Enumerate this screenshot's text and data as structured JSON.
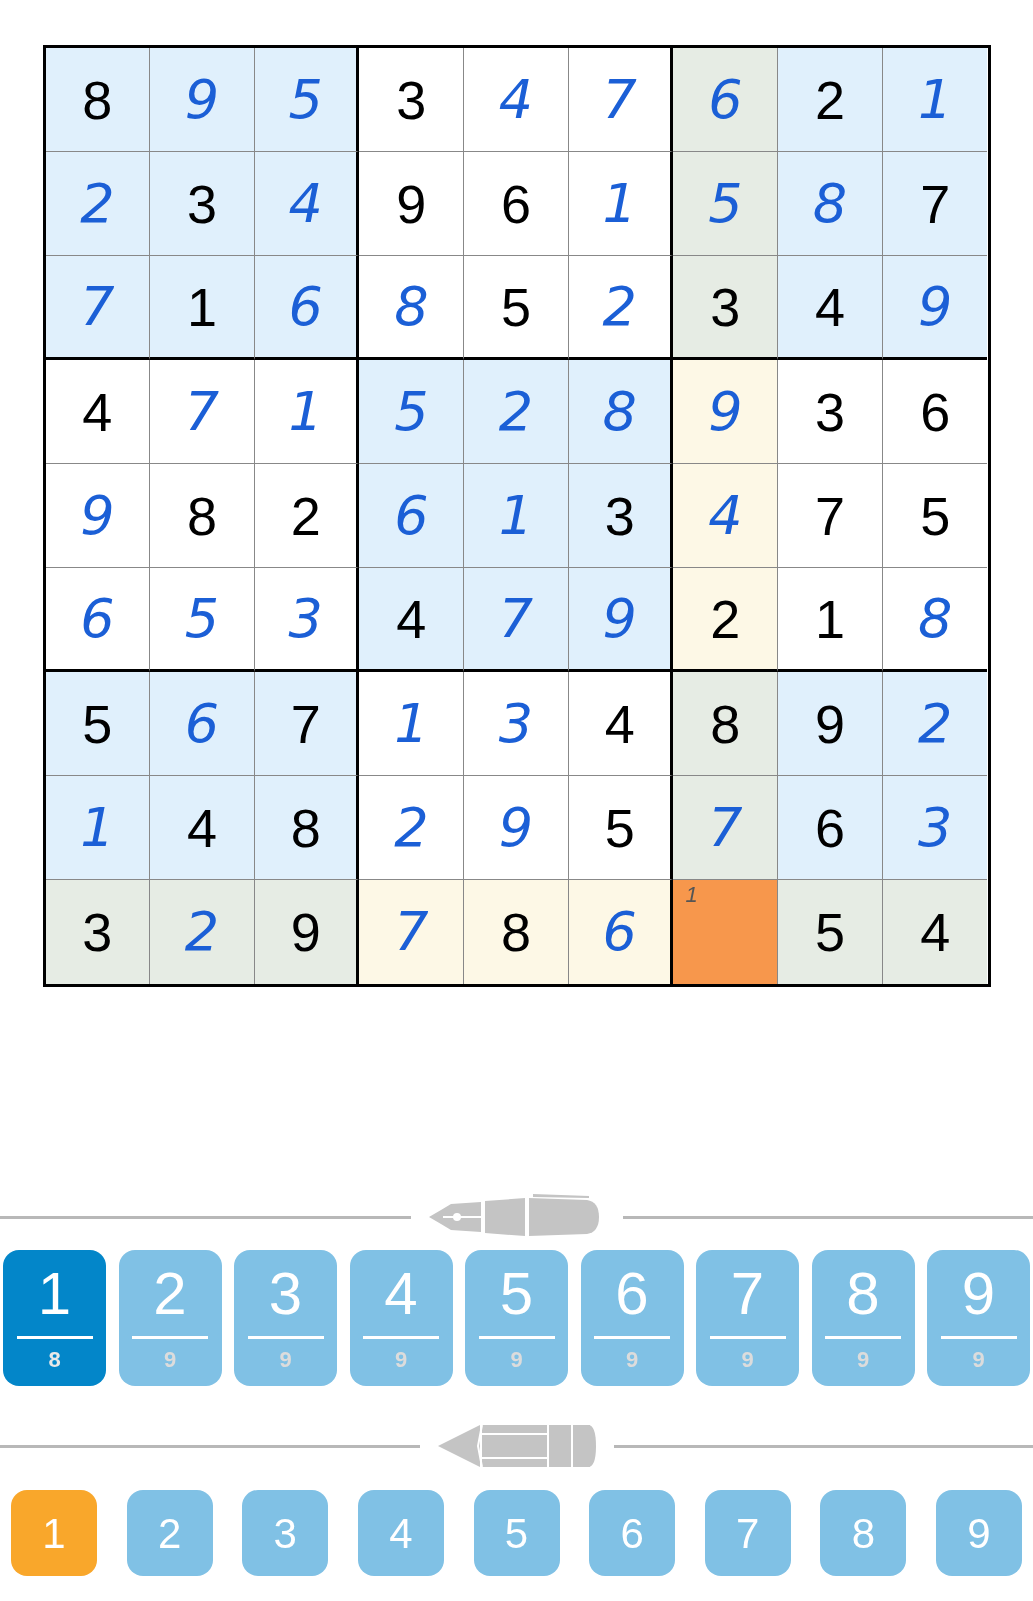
{
  "grid": [
    [
      {
        "value": "8",
        "kind": "given",
        "color": "#e0f0fc"
      },
      {
        "value": "9",
        "kind": "entered",
        "color": "#e0f0fc"
      },
      {
        "value": "5",
        "kind": "entered",
        "color": "#e0f0fc"
      },
      {
        "value": "3",
        "kind": "given",
        "color": "#ffffff"
      },
      {
        "value": "4",
        "kind": "entered",
        "color": "#ffffff"
      },
      {
        "value": "7",
        "kind": "entered",
        "color": "#ffffff"
      },
      {
        "value": "6",
        "kind": "entered",
        "color": "#e6ece4"
      },
      {
        "value": "2",
        "kind": "given",
        "color": "#e0f0fc"
      },
      {
        "value": "1",
        "kind": "entered",
        "color": "#e0f0fc"
      }
    ],
    [
      {
        "value": "2",
        "kind": "entered",
        "color": "#e0f0fc"
      },
      {
        "value": "3",
        "kind": "given",
        "color": "#e0f0fc"
      },
      {
        "value": "4",
        "kind": "entered",
        "color": "#e0f0fc"
      },
      {
        "value": "9",
        "kind": "given",
        "color": "#ffffff"
      },
      {
        "value": "6",
        "kind": "given",
        "color": "#ffffff"
      },
      {
        "value": "1",
        "kind": "entered",
        "color": "#ffffff"
      },
      {
        "value": "5",
        "kind": "entered",
        "color": "#e6ece4"
      },
      {
        "value": "8",
        "kind": "entered",
        "color": "#e0f0fc"
      },
      {
        "value": "7",
        "kind": "given",
        "color": "#e0f0fc"
      }
    ],
    [
      {
        "value": "7",
        "kind": "entered",
        "color": "#e0f0fc"
      },
      {
        "value": "1",
        "kind": "given",
        "color": "#e0f0fc"
      },
      {
        "value": "6",
        "kind": "entered",
        "color": "#e0f0fc"
      },
      {
        "value": "8",
        "kind": "entered",
        "color": "#ffffff"
      },
      {
        "value": "5",
        "kind": "given",
        "color": "#ffffff"
      },
      {
        "value": "2",
        "kind": "entered",
        "color": "#ffffff"
      },
      {
        "value": "3",
        "kind": "given",
        "color": "#e6ece4"
      },
      {
        "value": "4",
        "kind": "given",
        "color": "#e0f0fc"
      },
      {
        "value": "9",
        "kind": "entered",
        "color": "#e0f0fc"
      }
    ],
    [
      {
        "value": "4",
        "kind": "given",
        "color": "#ffffff"
      },
      {
        "value": "7",
        "kind": "entered",
        "color": "#ffffff"
      },
      {
        "value": "1",
        "kind": "entered",
        "color": "#ffffff"
      },
      {
        "value": "5",
        "kind": "entered",
        "color": "#e0f0fc"
      },
      {
        "value": "2",
        "kind": "entered",
        "color": "#e0f0fc"
      },
      {
        "value": "8",
        "kind": "entered",
        "color": "#e0f0fc"
      },
      {
        "value": "9",
        "kind": "entered",
        "color": "#fdf8e6"
      },
      {
        "value": "3",
        "kind": "given",
        "color": "#ffffff"
      },
      {
        "value": "6",
        "kind": "given",
        "color": "#ffffff"
      }
    ],
    [
      {
        "value": "9",
        "kind": "entered",
        "color": "#ffffff"
      },
      {
        "value": "8",
        "kind": "given",
        "color": "#ffffff"
      },
      {
        "value": "2",
        "kind": "given",
        "color": "#ffffff"
      },
      {
        "value": "6",
        "kind": "entered",
        "color": "#e0f0fc"
      },
      {
        "value": "1",
        "kind": "entered",
        "color": "#e0f0fc"
      },
      {
        "value": "3",
        "kind": "given",
        "color": "#e0f0fc"
      },
      {
        "value": "4",
        "kind": "entered",
        "color": "#fdf8e6"
      },
      {
        "value": "7",
        "kind": "given",
        "color": "#ffffff"
      },
      {
        "value": "5",
        "kind": "given",
        "color": "#ffffff"
      }
    ],
    [
      {
        "value": "6",
        "kind": "entered",
        "color": "#ffffff"
      },
      {
        "value": "5",
        "kind": "entered",
        "color": "#ffffff"
      },
      {
        "value": "3",
        "kind": "entered",
        "color": "#ffffff"
      },
      {
        "value": "4",
        "kind": "given",
        "color": "#e0f0fc"
      },
      {
        "value": "7",
        "kind": "entered",
        "color": "#e0f0fc"
      },
      {
        "value": "9",
        "kind": "entered",
        "color": "#e0f0fc"
      },
      {
        "value": "2",
        "kind": "given",
        "color": "#fdf8e6"
      },
      {
        "value": "1",
        "kind": "given",
        "color": "#ffffff"
      },
      {
        "value": "8",
        "kind": "entered",
        "color": "#ffffff"
      }
    ],
    [
      {
        "value": "5",
        "kind": "given",
        "color": "#e0f0fc"
      },
      {
        "value": "6",
        "kind": "entered",
        "color": "#e0f0fc"
      },
      {
        "value": "7",
        "kind": "given",
        "color": "#e0f0fc"
      },
      {
        "value": "1",
        "kind": "entered",
        "color": "#ffffff"
      },
      {
        "value": "3",
        "kind": "entered",
        "color": "#ffffff"
      },
      {
        "value": "4",
        "kind": "given",
        "color": "#ffffff"
      },
      {
        "value": "8",
        "kind": "given",
        "color": "#e6ece4"
      },
      {
        "value": "9",
        "kind": "given",
        "color": "#e0f0fc"
      },
      {
        "value": "2",
        "kind": "entered",
        "color": "#e0f0fc"
      }
    ],
    [
      {
        "value": "1",
        "kind": "entered",
        "color": "#e0f0fc"
      },
      {
        "value": "4",
        "kind": "given",
        "color": "#e0f0fc"
      },
      {
        "value": "8",
        "kind": "given",
        "color": "#e0f0fc"
      },
      {
        "value": "2",
        "kind": "entered",
        "color": "#ffffff"
      },
      {
        "value": "9",
        "kind": "entered",
        "color": "#ffffff"
      },
      {
        "value": "5",
        "kind": "given",
        "color": "#ffffff"
      },
      {
        "value": "7",
        "kind": "entered",
        "color": "#e6ece4"
      },
      {
        "value": "6",
        "kind": "given",
        "color": "#e0f0fc"
      },
      {
        "value": "3",
        "kind": "entered",
        "color": "#e0f0fc"
      }
    ],
    [
      {
        "value": "3",
        "kind": "given",
        "color": "#e6ece4"
      },
      {
        "value": "2",
        "kind": "entered",
        "color": "#e6ece4"
      },
      {
        "value": "9",
        "kind": "given",
        "color": "#e6ece4"
      },
      {
        "value": "7",
        "kind": "entered",
        "color": "#fdf8e6"
      },
      {
        "value": "8",
        "kind": "given",
        "color": "#fdf8e6"
      },
      {
        "value": "6",
        "kind": "entered",
        "color": "#fdf8e6"
      },
      {
        "note": "1",
        "kind": "note",
        "color": "#f7974c"
      },
      {
        "value": "5",
        "kind": "given",
        "color": "#e6ece4"
      },
      {
        "value": "4",
        "kind": "given",
        "color": "#e6ece4"
      }
    ]
  ],
  "pen_buttons": [
    {
      "digit": "1",
      "count": "8",
      "selected": true
    },
    {
      "digit": "2",
      "count": "9",
      "selected": false
    },
    {
      "digit": "3",
      "count": "9",
      "selected": false
    },
    {
      "digit": "4",
      "count": "9",
      "selected": false
    },
    {
      "digit": "5",
      "count": "9",
      "selected": false
    },
    {
      "digit": "6",
      "count": "9",
      "selected": false
    },
    {
      "digit": "7",
      "count": "9",
      "selected": false
    },
    {
      "digit": "8",
      "count": "9",
      "selected": false
    },
    {
      "digit": "9",
      "count": "9",
      "selected": false
    }
  ],
  "note_buttons": [
    {
      "digit": "1",
      "selected": true
    },
    {
      "digit": "2",
      "selected": false
    },
    {
      "digit": "3",
      "selected": false
    },
    {
      "digit": "4",
      "selected": false
    },
    {
      "digit": "5",
      "selected": false
    },
    {
      "digit": "6",
      "selected": false
    },
    {
      "digit": "7",
      "selected": false
    },
    {
      "digit": "8",
      "selected": false
    },
    {
      "digit": "9",
      "selected": false
    }
  ]
}
